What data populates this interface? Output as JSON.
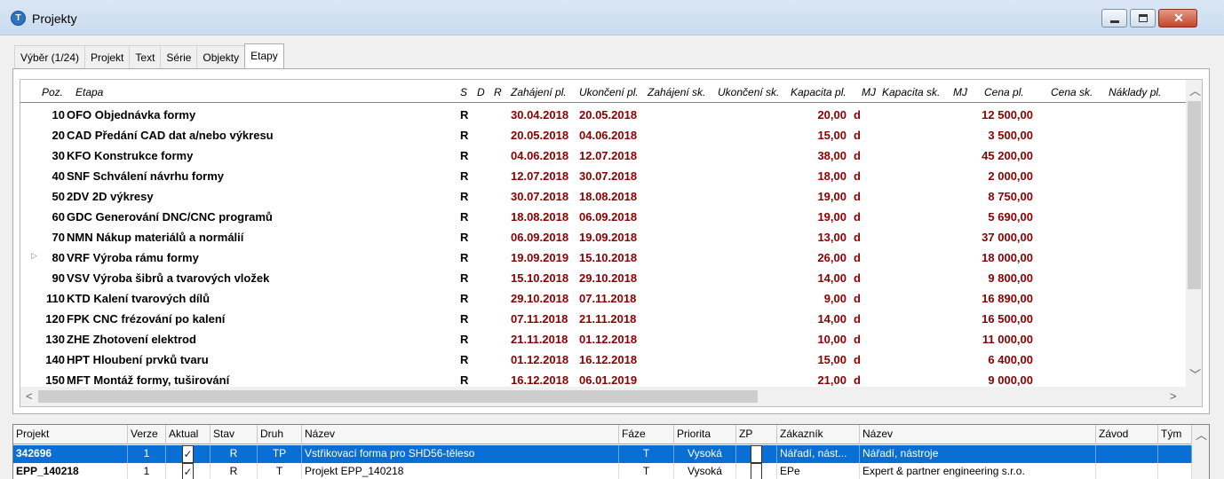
{
  "window": {
    "title": "Projekty",
    "app_icon": "T"
  },
  "tabs": [
    {
      "label": "Výběr (1/24)",
      "active": false
    },
    {
      "label": "Projekt",
      "active": false
    },
    {
      "label": "Text",
      "active": false
    },
    {
      "label": "Série",
      "active": false
    },
    {
      "label": "Objekty",
      "active": false
    },
    {
      "label": "Etapy",
      "active": true
    }
  ],
  "etapy": {
    "headers": {
      "poz": "Poz.",
      "etapa": "Etapa",
      "s": "S",
      "d": "D",
      "r": "R",
      "zahajeni_pl": "Zahájení pl.",
      "ukonceni_pl": "Ukončení pl.",
      "zahajeni_sk": "Zahájení sk.",
      "ukonceni_sk": "Ukončení sk.",
      "kapacita_pl": "Kapacita pl.",
      "mj": "MJ",
      "kapacita_sk": "Kapacita sk.",
      "mj2": "MJ",
      "cena_pl": "Cena pl.",
      "cena_sk": "Cena sk.",
      "naklady_pl": "Náklady pl."
    },
    "rows": [
      {
        "poz": "10",
        "etapa": "OFO Objednávka formy",
        "r": "R",
        "zah": "30.04.2018",
        "uk": "20.05.2018",
        "kap": "20,00",
        "mj": "d",
        "cena": "12 500,00"
      },
      {
        "poz": "20",
        "etapa": "CAD Předání CAD dat a/nebo výkresu",
        "r": "R",
        "zah": "20.05.2018",
        "uk": "04.06.2018",
        "kap": "15,00",
        "mj": "d",
        "cena": "3 500,00"
      },
      {
        "poz": "30",
        "etapa": "KFO Konstrukce formy",
        "r": "R",
        "zah": "04.06.2018",
        "uk": "12.07.2018",
        "kap": "38,00",
        "mj": "d",
        "cena": "45 200,00"
      },
      {
        "poz": "40",
        "etapa": "SNF Schválení návrhu formy",
        "r": "R",
        "zah": "12.07.2018",
        "uk": "30.07.2018",
        "kap": "18,00",
        "mj": "d",
        "cena": "2 000,00"
      },
      {
        "poz": "50",
        "etapa": "2DV 2D výkresy",
        "r": "R",
        "zah": "30.07.2018",
        "uk": "18.08.2018",
        "kap": "19,00",
        "mj": "d",
        "cena": "8 750,00"
      },
      {
        "poz": "60",
        "etapa": "GDC Generování DNC/CNC programů",
        "r": "R",
        "zah": "18.08.2018",
        "uk": "06.09.2018",
        "kap": "19,00",
        "mj": "d",
        "cena": "5 690,00"
      },
      {
        "poz": "70",
        "etapa": "NMN Nákup materiálů a normálií",
        "r": "R",
        "zah": "06.09.2018",
        "uk": "19.09.2018",
        "kap": "13,00",
        "mj": "d",
        "cena": "37 000,00"
      },
      {
        "poz": "80",
        "etapa": "VRF Výroba rámu formy",
        "r": "R",
        "zah": "19.09.2019",
        "uk": "15.10.2018",
        "kap": "26,00",
        "mj": "d",
        "cena": "18 000,00",
        "current": true
      },
      {
        "poz": "90",
        "etapa": "VSV Výroba šibrů a tvarových vložek",
        "r": "R",
        "zah": "15.10.2018",
        "uk": "29.10.2018",
        "kap": "14,00",
        "mj": "d",
        "cena": "9 800,00"
      },
      {
        "poz": "110",
        "etapa": "KTD Kalení tvarových dílů",
        "r": "R",
        "zah": "29.10.2018",
        "uk": "07.11.2018",
        "kap": "9,00",
        "mj": "d",
        "cena": "16 890,00"
      },
      {
        "poz": "120",
        "etapa": "FPK CNC frézování po kalení",
        "r": "R",
        "zah": "07.11.2018",
        "uk": "21.11.2018",
        "kap": "14,00",
        "mj": "d",
        "cena": "16 500,00"
      },
      {
        "poz": "130",
        "etapa": "ZHE Zhotovení elektrod",
        "r": "R",
        "zah": "21.11.2018",
        "uk": "01.12.2018",
        "kap": "10,00",
        "mj": "d",
        "cena": "11 000,00"
      },
      {
        "poz": "140",
        "etapa": "HPT Hloubení prvků tvaru",
        "r": "R",
        "zah": "01.12.2018",
        "uk": "16.12.2018",
        "kap": "15,00",
        "mj": "d",
        "cena": "6 400,00"
      },
      {
        "poz": "150",
        "etapa": "MFT Montáž formy, tuširování",
        "r": "R",
        "zah": "16.12.2018",
        "uk": "06.01.2019",
        "kap": "21,00",
        "mj": "d",
        "cena": "9 000,00"
      }
    ],
    "scroll": {
      "left": "<",
      "right": ">",
      "up": "^",
      "down": "v"
    }
  },
  "projekty": {
    "headers": [
      "Projekt",
      "Verze",
      "Aktual",
      "Stav",
      "Druh",
      "Název",
      "Fáze",
      "Priorita",
      "ZP",
      "Zákazník",
      "Název",
      "Závod",
      "Tým"
    ],
    "rows": [
      {
        "projekt": "342696",
        "verze": "1",
        "aktual": true,
        "stav": "R",
        "druh": "TP",
        "nazev": "Vstřikovací forma pro SHD56-těleso",
        "faze": "T",
        "priorita": "Vysoká",
        "zp": false,
        "zakaznik": "Nářadí, nást...",
        "nazev2": "Nářadí, nástroje",
        "zavod": "",
        "tym": "",
        "selected": true
      },
      {
        "projekt": "EPP_140218",
        "verze": "1",
        "aktual": true,
        "stav": "R",
        "druh": "T",
        "nazev": "Projekt EPP_140218",
        "faze": "T",
        "priorita": "Vysoká",
        "zp": false,
        "zakaznik": "EPe",
        "nazev2": "Expert & partner engineering s.r.o.",
        "zavod": "",
        "tym": "",
        "selected": false
      }
    ]
  }
}
